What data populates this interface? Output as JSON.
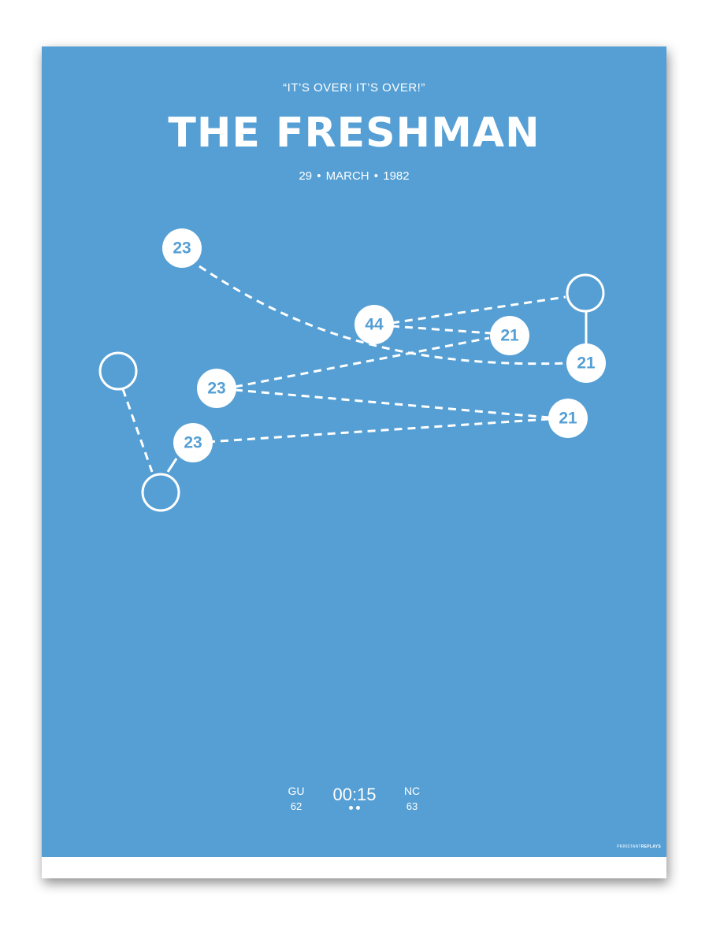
{
  "poster": {
    "quote": "“IT’S OVER! IT’S OVER!”",
    "title": "THE FRESHMAN",
    "date": "29  •  MARCH  •  1982",
    "background_color": "#559fd4",
    "mark_color": "#ffffff"
  },
  "players": [
    {
      "number": "23"
    },
    {
      "number": "44"
    },
    {
      "number": "21"
    },
    {
      "number": "21"
    },
    {
      "number": "23"
    },
    {
      "number": "21"
    },
    {
      "number": "23"
    }
  ],
  "scoreboard": {
    "home": {
      "abbr": "GU",
      "score": "62"
    },
    "clock": "00:15",
    "away": {
      "abbr": "NC",
      "score": "63"
    }
  },
  "brand": {
    "prefix": "PRINSTANT",
    "suffix": "REPLAYS"
  }
}
